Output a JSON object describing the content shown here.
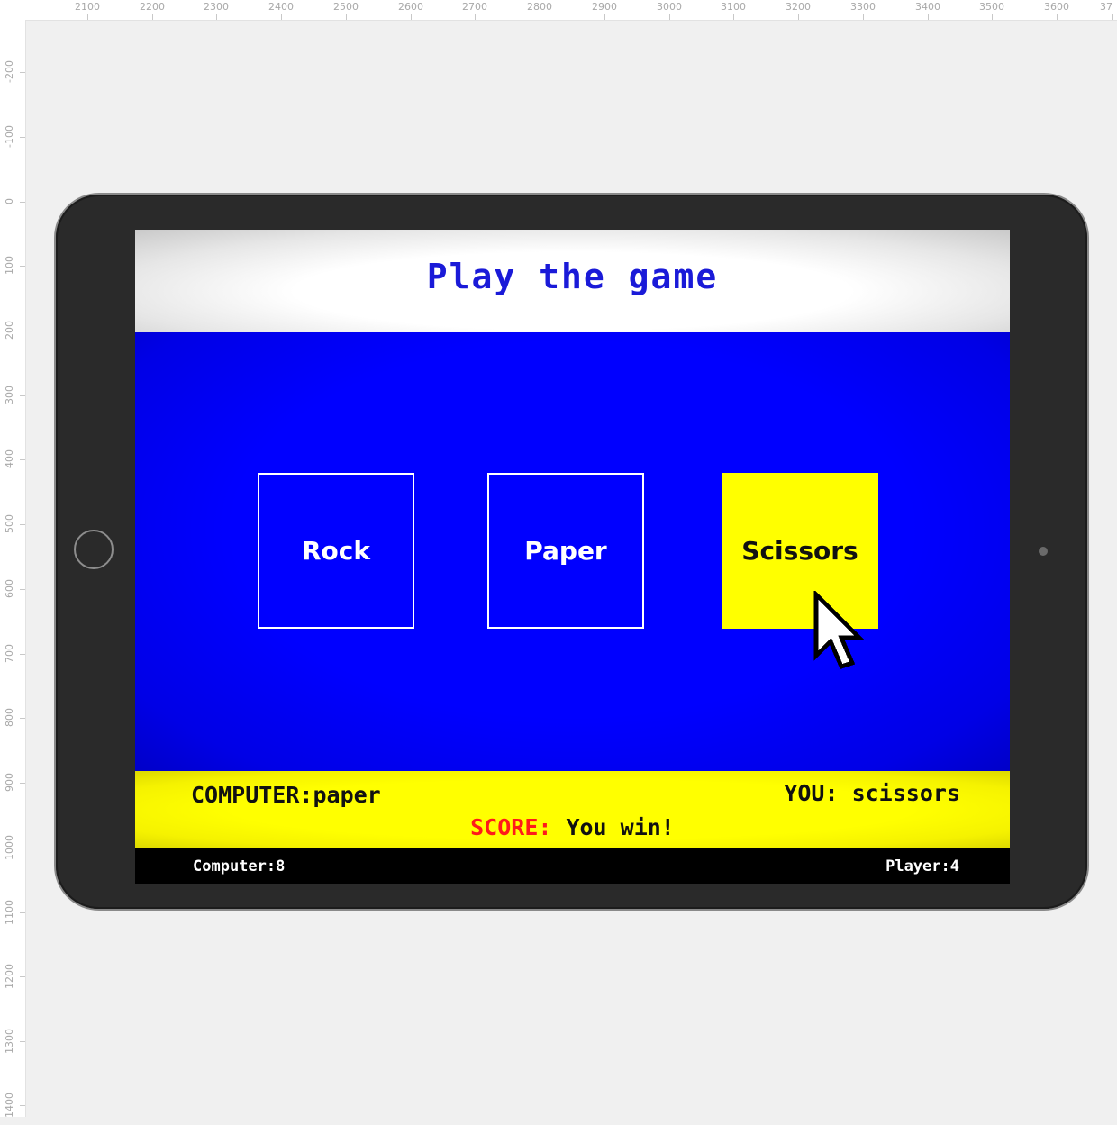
{
  "ruler": {
    "top_labels": [
      "2100",
      "2200",
      "2300",
      "2400",
      "2500",
      "2600",
      "2700",
      "2800",
      "2900",
      "3000",
      "3100",
      "3200",
      "3300",
      "3400",
      "3500",
      "3600",
      "37"
    ],
    "left_labels": [
      "-200",
      "-100",
      "0",
      "100",
      "200",
      "300",
      "400",
      "500",
      "600",
      "700",
      "800",
      "900",
      "1000",
      "1100",
      "1200",
      "1300",
      "1400"
    ]
  },
  "game": {
    "title": "Play the game",
    "choices": {
      "rock": "Rock",
      "paper": "Paper",
      "scissors": "Scissors"
    },
    "result": {
      "computer_label": "COMPUTER:",
      "computer_choice": "paper",
      "you_label": "YOU:",
      "you_choice": "scissors",
      "score_label": "SCORE:",
      "score_text": "You win!"
    },
    "totals": {
      "computer_label": "Computer:",
      "computer_score": "8",
      "player_label": "Player:",
      "player_score": "4"
    }
  },
  "colors": {
    "play_area": "#0000ff",
    "selected_choice": "#ffff00",
    "result_bar": "#ffff00",
    "score_label": "#ff1a1a",
    "title": "#1a1ad8"
  },
  "icons": {
    "cursor": "arrow-cursor-icon",
    "home_button": "home-button-icon",
    "camera": "camera-icon"
  }
}
